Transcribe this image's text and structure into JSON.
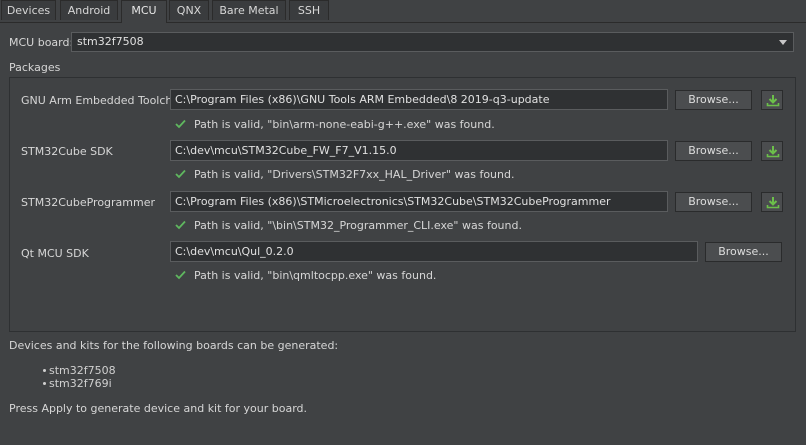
{
  "tabs": [
    {
      "label": "Devices"
    },
    {
      "label": "Android"
    },
    {
      "label": "MCU"
    },
    {
      "label": "QNX"
    },
    {
      "label": "Bare Metal"
    },
    {
      "label": "SSH"
    }
  ],
  "mcu_board": {
    "label": "MCU board:",
    "selected": "stm32f7508"
  },
  "packages": {
    "title": "Packages",
    "browse_label": "Browse...",
    "items": [
      {
        "name": "GNU Arm Embedded Toolchain",
        "path": "C:\\Program Files (x86)\\GNU Tools ARM Embedded\\8 2019-q3-update",
        "status": "Path is valid, \"bin\\arm-none-eabi-g++.exe\" was found."
      },
      {
        "name": "STM32Cube SDK",
        "path": "C:\\dev\\mcu\\STM32Cube_FW_F7_V1.15.0",
        "status": "Path is valid, \"Drivers\\STM32F7xx_HAL_Driver\" was found."
      },
      {
        "name": "STM32CubeProgrammer",
        "path": "C:\\Program Files (x86)\\STMicroelectronics\\STM32Cube\\STM32CubeProgrammer",
        "status": "Path is valid, \"\\bin\\STM32_Programmer_CLI.exe\" was found."
      },
      {
        "name": "Qt MCU SDK",
        "path": "C:\\dev\\mcu\\Qul_0.2.0",
        "status": "Path is valid, \"bin\\qmltocpp.exe\" was found."
      }
    ]
  },
  "boards_info": "Devices and kits for the following boards can be generated:",
  "boards": [
    "stm32f7508",
    "stm32f769i"
  ],
  "footer_hint": "Press Apply to generate device and kit for your board.",
  "colors": {
    "background": "#404244",
    "valid_check": "#5fb85f",
    "download_arrow": "#6cc04a"
  }
}
